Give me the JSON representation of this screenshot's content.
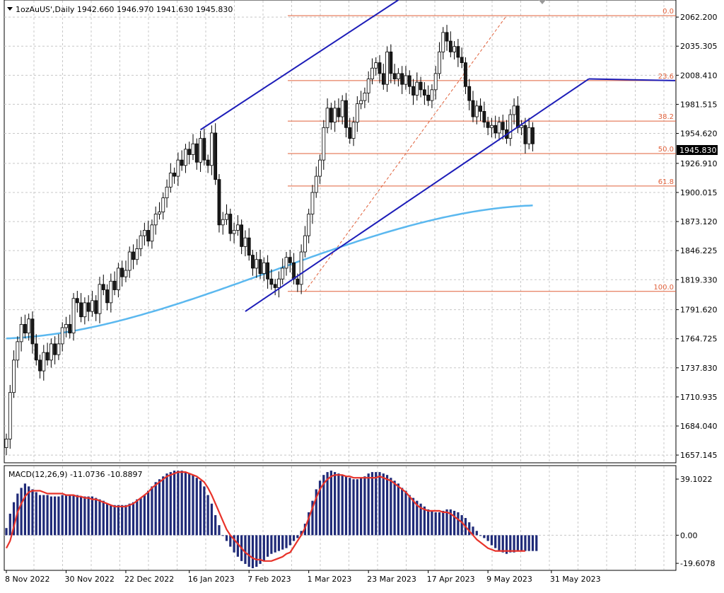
{
  "header": {
    "symbol_title": "1ozAuUS',Daily  1942.660 1946.970 1941.630 1945.830"
  },
  "macd_header": "MACD(12,26,9) -11.0736 -10.8897",
  "current_price_label": "1945.830",
  "colors": {
    "bull_candle": "#1a1a1a",
    "bear_candle": "#1a1a1a",
    "channel": "#1d1db8",
    "moving_average": "#5bb8ef",
    "fib": "#e0603a",
    "macd_hist": "#1f2a78",
    "macd_signal": "#e8332a",
    "grid": "#c8c8c8"
  },
  "chart_data": [
    {
      "type": "candlestick",
      "title": "1ozAuUS',Daily",
      "ylim": [
        1650,
        2078
      ],
      "y_ticks": [
        "2062.200",
        "2035.305",
        "2008.410",
        "1981.515",
        "1954.620",
        "1926.910",
        "1900.015",
        "1873.120",
        "1846.225",
        "1819.330",
        "1791.620",
        "1764.725",
        "1737.830",
        "1710.935",
        "1684.040",
        "1657.145"
      ],
      "x_ticks": [
        "8 Nov 2022",
        "30 Nov 2022",
        "22 Dec 2022",
        "16 Jan 2023",
        "7 Feb 2023",
        "1 Mar 2023",
        "23 Mar 2023",
        "17 Apr 2023",
        "9 May 2023",
        "31 May 2023"
      ],
      "close": [
        1672,
        1715,
        1745,
        1762,
        1778,
        1770,
        1783,
        1760,
        1745,
        1735,
        1752,
        1745,
        1760,
        1750,
        1760,
        1775,
        1778,
        1770,
        1802,
        1798,
        1785,
        1798,
        1790,
        1800,
        1788,
        1815,
        1810,
        1798,
        1818,
        1810,
        1830,
        1822,
        1828,
        1845,
        1838,
        1848,
        1860,
        1865,
        1855,
        1870,
        1880,
        1882,
        1895,
        1905,
        1918,
        1915,
        1930,
        1925,
        1940,
        1935,
        1945,
        1928,
        1950,
        1930,
        1925,
        1955,
        1912,
        1870,
        1875,
        1880,
        1862,
        1865,
        1870,
        1850,
        1858,
        1842,
        1830,
        1838,
        1825,
        1835,
        1820,
        1815,
        1812,
        1820,
        1830,
        1840,
        1835,
        1820,
        1815,
        1845,
        1860,
        1880,
        1900,
        1915,
        1930,
        1960,
        1978,
        1965,
        1978,
        1970,
        1985,
        1960,
        1950,
        1965,
        1982,
        1985,
        1992,
        2005,
        2015,
        2020,
        2010,
        2000,
        2030,
        2010,
        2005,
        2010,
        2000,
        2008,
        1998,
        1990,
        2002,
        1995,
        1990,
        1985,
        1995,
        2010,
        2030,
        2048,
        2040,
        2030,
        2035,
        2025,
        2020,
        1998,
        1985,
        1970,
        1980,
        1975,
        1965,
        1960,
        1962,
        1955,
        1965,
        1958,
        1950,
        1972,
        1980,
        1960,
        1962,
        1945,
        1960,
        1945
      ],
      "ma": {
        "start": 1765,
        "end": 1888
      },
      "fib_levels": [
        {
          "label": "0.0",
          "price": 2063.5
        },
        {
          "label": "23.6",
          "price": 2003.5
        },
        {
          "label": "38.2",
          "price": 1966.0
        },
        {
          "label": "50.0",
          "price": 1936.0
        },
        {
          "label": "61.8",
          "price": 1906.0
        },
        {
          "label": "100.0",
          "price": 1808.5
        }
      ],
      "channel": {
        "upper": [
          [
            52,
            1958
          ],
          [
            105,
            2078
          ]
        ],
        "lower": [
          [
            64,
            1790
          ],
          [
            156,
            2005
          ]
        ]
      }
    },
    {
      "type": "bar",
      "title": "MACD(12,26,9)",
      "ylim": [
        -24,
        48
      ],
      "y_ticks": [
        "39.1022",
        "0.00",
        "-19.6078"
      ],
      "histogram": [
        5,
        15,
        23,
        29,
        33,
        36,
        34,
        32,
        30,
        28,
        28,
        28,
        27,
        27,
        27,
        28,
        28,
        28,
        28,
        28,
        27,
        27,
        27,
        27,
        26,
        25,
        24,
        22,
        21,
        21,
        21,
        21,
        21,
        22,
        23,
        25,
        26,
        28,
        31,
        34,
        37,
        39,
        41,
        43,
        44,
        45,
        45,
        45,
        44,
        43,
        42,
        40,
        38,
        34,
        28,
        22,
        14,
        7,
        0,
        -4,
        -8,
        -12,
        -15,
        -18,
        -20,
        -22,
        -23,
        -22,
        -20,
        -18,
        -15,
        -13,
        -12,
        -11,
        -10,
        -9,
        -7,
        -4,
        -2,
        3,
        8,
        16,
        24,
        32,
        38,
        42,
        44,
        45,
        44,
        43,
        42,
        41,
        40,
        39,
        39,
        40,
        41,
        43,
        44,
        44,
        44,
        43,
        42,
        40,
        38,
        36,
        33,
        31,
        28,
        26,
        24,
        22,
        20,
        18,
        17,
        16,
        16,
        17,
        18,
        18,
        17,
        16,
        14,
        12,
        9,
        6,
        3,
        0,
        -2,
        -4,
        -7,
        -9,
        -11,
        -12,
        -13,
        -12,
        -12,
        -11,
        -11,
        -11,
        -11,
        -11,
        -11
      ],
      "signal": [
        -9,
        -4,
        6,
        16,
        22,
        27,
        30,
        31,
        31,
        31,
        30,
        29,
        29,
        29,
        29,
        29,
        28,
        28,
        28,
        27,
        27,
        26,
        26,
        25,
        25,
        24,
        23,
        22,
        21,
        20,
        20,
        20,
        20,
        21,
        22,
        24,
        26,
        28,
        30,
        33,
        35,
        37,
        39,
        41,
        42,
        43,
        44,
        44,
        44,
        43,
        42,
        41,
        39,
        37,
        33,
        28,
        22,
        16,
        10,
        4,
        0,
        -3,
        -6,
        -9,
        -12,
        -14,
        -16,
        -17,
        -17,
        -18,
        -18,
        -18,
        -17,
        -16,
        -15,
        -13,
        -12,
        -8,
        -4,
        0,
        5,
        12,
        19,
        26,
        32,
        36,
        39,
        41,
        42,
        42,
        42,
        41,
        41,
        40,
        40,
        40,
        40,
        40,
        40,
        40,
        41,
        40,
        39,
        38,
        36,
        34,
        32,
        30,
        27,
        24,
        21,
        19,
        18,
        17,
        17,
        17,
        17,
        16,
        16,
        15,
        13,
        11,
        9,
        6,
        3,
        0,
        -3,
        -5,
        -7,
        -9,
        -10,
        -11,
        -11,
        -11,
        -11,
        -11,
        -11,
        -11,
        -11,
        -11
      ]
    }
  ]
}
